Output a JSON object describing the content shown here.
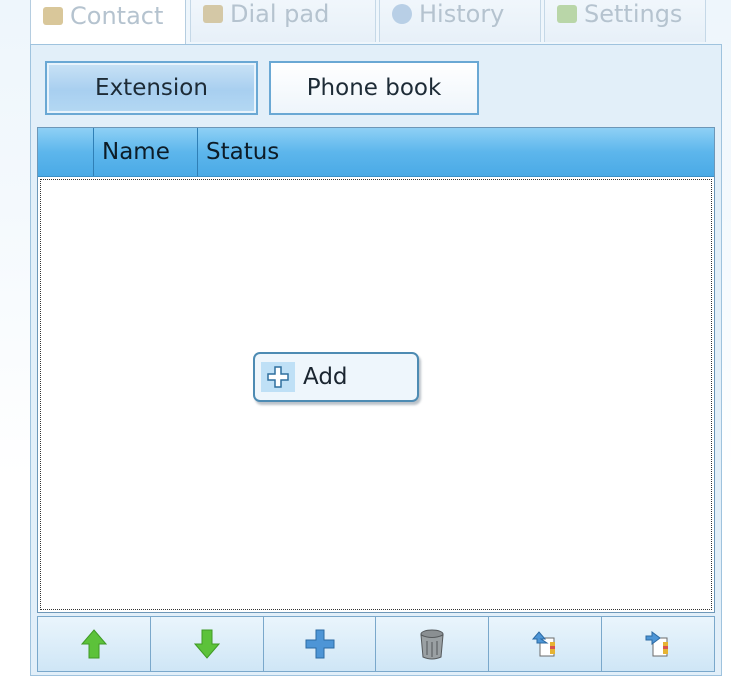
{
  "tabs": [
    {
      "label": "Contact",
      "icon": "contact-card-icon"
    },
    {
      "label": "Dial pad",
      "icon": "dial-pad-icon"
    },
    {
      "label": "History",
      "icon": "history-clock-icon"
    },
    {
      "label": "Settings",
      "icon": "settings-tools-icon"
    }
  ],
  "subtabs": {
    "extension_label": "Extension",
    "phonebook_label": "Phone book",
    "selected": "Extension"
  },
  "grid": {
    "columns": [
      "",
      "Name",
      "Status"
    ],
    "rows": []
  },
  "add_button": {
    "label": "Add",
    "icon": "plus-icon"
  },
  "toolbar": {
    "buttons": [
      {
        "icon": "arrow-up-icon",
        "action": "move-up"
      },
      {
        "icon": "arrow-down-icon",
        "action": "move-down"
      },
      {
        "icon": "plus-icon",
        "action": "add"
      },
      {
        "icon": "trash-can-icon",
        "action": "delete"
      },
      {
        "icon": "import-icon",
        "action": "import"
      },
      {
        "icon": "export-icon",
        "action": "export"
      }
    ]
  },
  "colors": {
    "accent": "#5db6ec",
    "panel_bg": "#e2eff9",
    "arrow_green": "#5cc23a",
    "plus_blue": "#4d95d6"
  }
}
